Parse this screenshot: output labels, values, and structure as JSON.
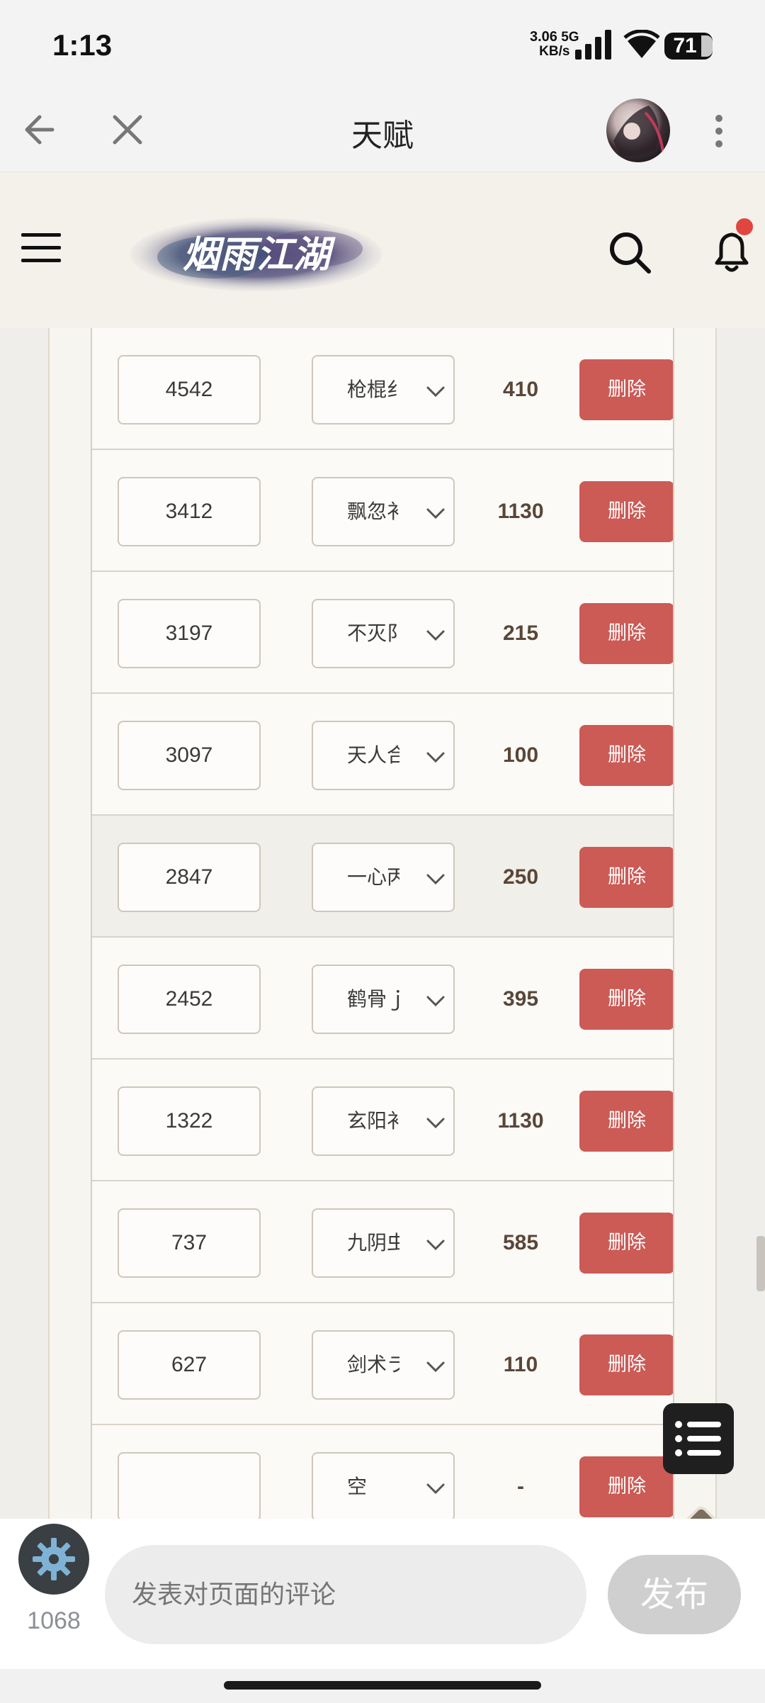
{
  "status_bar": {
    "time": "1:13",
    "net_speed": "3.06",
    "net_unit": "KB/s",
    "net_type": "5G",
    "battery": "71"
  },
  "nav": {
    "title": "天赋"
  },
  "site": {
    "logo_text": "烟雨江湖",
    "notification_color": "#e0463f"
  },
  "table": {
    "delete_label": "删除",
    "rows": [
      {
        "id": "4542",
        "talent": "枪棍纟",
        "cost": "410"
      },
      {
        "id": "3412",
        "talent": "飘忽衤",
        "cost": "1130"
      },
      {
        "id": "3197",
        "talent": "不灭阝",
        "cost": "215"
      },
      {
        "id": "3097",
        "talent": "天人合",
        "cost": "100"
      },
      {
        "id": "2847",
        "talent": "一心丙",
        "cost": "250"
      },
      {
        "id": "2452",
        "talent": "鹤骨ｊ",
        "cost": "395"
      },
      {
        "id": "1322",
        "talent": "玄阳衤",
        "cost": "1130"
      },
      {
        "id": "737",
        "talent": "九阴虫",
        "cost": "585"
      },
      {
        "id": "627",
        "talent": "剑术ラ",
        "cost": "110"
      },
      {
        "id": "",
        "talent": "空",
        "cost": "-"
      }
    ]
  },
  "bottom_bar": {
    "count": "1068",
    "comment_placeholder": "发表对页面的评论",
    "post_label": "发布"
  }
}
